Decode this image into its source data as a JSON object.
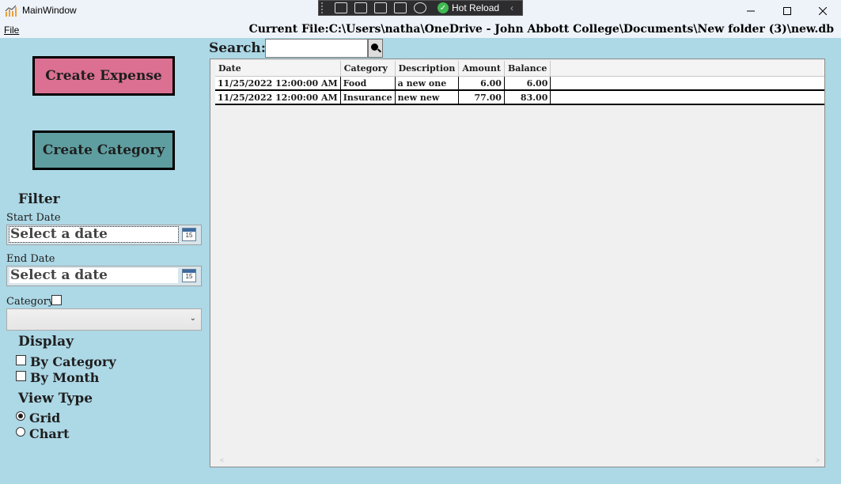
{
  "window": {
    "title": "MainWindow",
    "minimize_icon": "minimize-icon",
    "maximize_icon": "maximize-icon",
    "close_icon": "close-icon"
  },
  "devbar": {
    "hot_reload_label": "Hot Reload"
  },
  "menu": {
    "file": "File"
  },
  "current_file": "Current File:C:\\Users\\natha\\OneDrive - John Abbott College\\Documents\\New folder (3)\\new.db",
  "sidebar": {
    "create_expense": "Create Expense",
    "create_category": "Create Category",
    "filter_heading": "Filter",
    "start_date_label": "Start Date",
    "start_date_placeholder": "Select a date",
    "end_date_label": "End Date",
    "end_date_placeholder": "Select a date",
    "calendar_day": "15",
    "category_label": "Category",
    "display_heading": "Display",
    "by_category": "By Category",
    "by_month": "By Month",
    "view_type_heading": "View Type",
    "grid_option": "Grid",
    "chart_option": "Chart",
    "selected_view": "Grid"
  },
  "search": {
    "label": "Search:",
    "value": ""
  },
  "table": {
    "columns": [
      "Date",
      "Category",
      "Description",
      "Amount",
      "Balance"
    ],
    "rows": [
      [
        "11/25/2022 12:00:00 AM",
        "Food",
        "a new one",
        "6.00",
        "6.00"
      ],
      [
        "11/25/2022 12:00:00 AM",
        "Insurance",
        "new new",
        "77.00",
        "83.00"
      ]
    ]
  },
  "colors": {
    "background": "#add8e6",
    "expense_button": "#db7093",
    "category_button": "#5f9ea0"
  }
}
